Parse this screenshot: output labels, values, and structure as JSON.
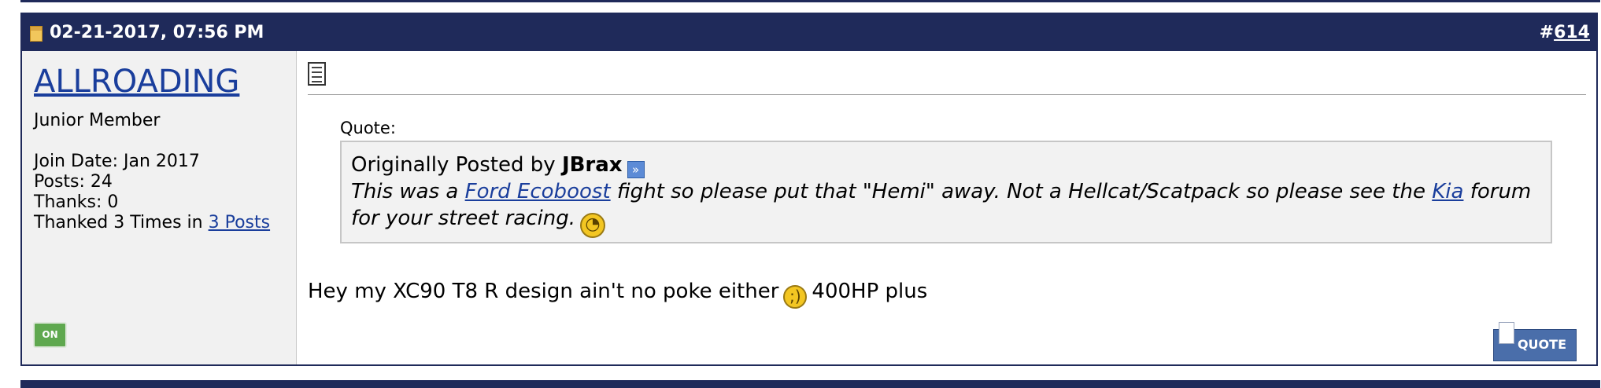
{
  "post": {
    "date": "02-21-2017, 07:56 PM",
    "number_prefix": "#",
    "number": "614"
  },
  "user": {
    "name": "ALLROADING",
    "title": "Junior Member",
    "join_date": "Join Date: Jan 2017",
    "posts": "Posts: 24",
    "thanks": "Thanks: 0",
    "thanked_prefix": "Thanked 3 Times in ",
    "thanked_link": "3 Posts",
    "status": "ON"
  },
  "quote": {
    "label": "Quote:",
    "posted_by_prefix": "Originally Posted by ",
    "author": "JBrax",
    "text_1": "This was a ",
    "link_1": "Ford Ecoboost",
    "text_2": " fight so please put that \"Hemi\" away. Not a Hellcat/Scatpack so please see the ",
    "link_2": "Kia",
    "text_3": " forum for your street racing.",
    "smiley": "rolleyes"
  },
  "message": {
    "text_1": "Hey my XC90 T8 R design ain't no poke either",
    "smiley": "wink",
    "text_2": "400HP plus"
  },
  "buttons": {
    "quote_label": "QUOTE"
  },
  "colors": {
    "header_bg": "#1f2a5a",
    "link": "#1a3e9c",
    "sidebar_bg": "#f1f1f1",
    "quote_bg": "#f2f2f2",
    "online": "#5fa84f",
    "quote_button": "#4a6eaa"
  }
}
